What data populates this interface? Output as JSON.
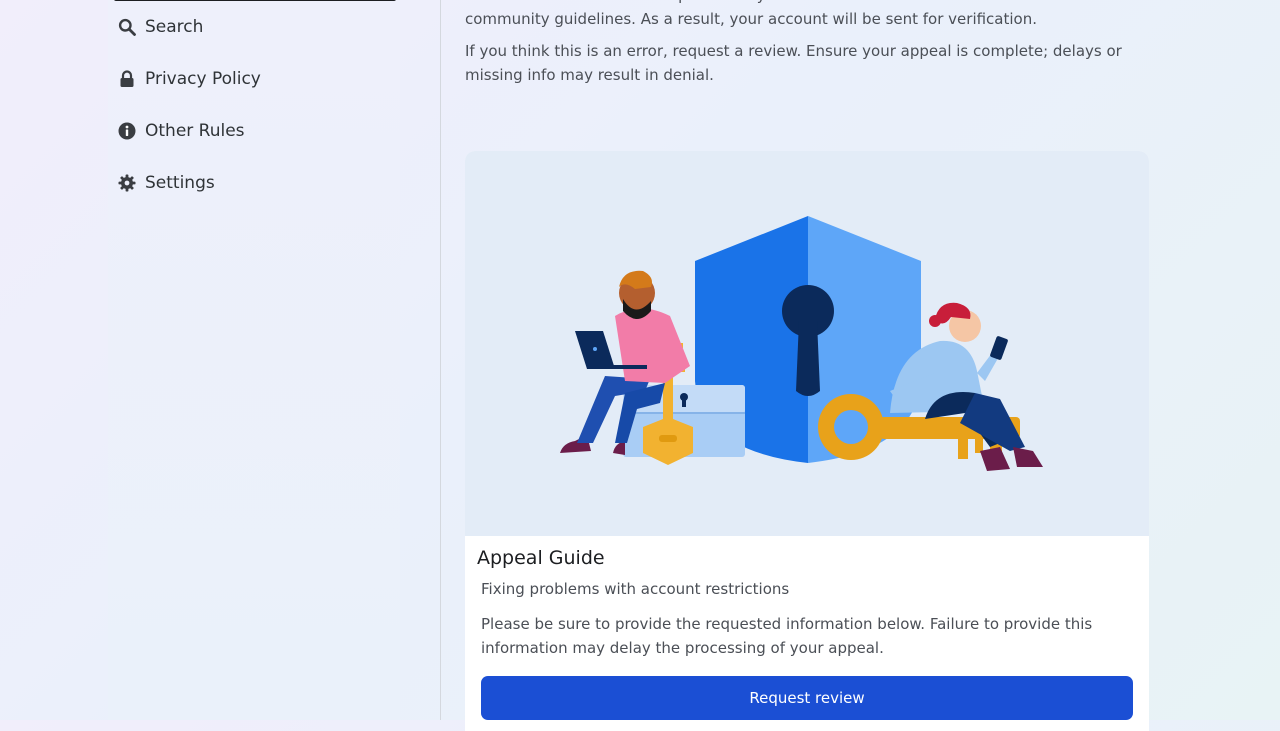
{
  "sidebar": {
    "items": [
      {
        "label": "Search",
        "icon": "search-icon"
      },
      {
        "label": "Privacy Policy",
        "icon": "lock-icon"
      },
      {
        "label": "Other Rules",
        "icon": "info-icon"
      },
      {
        "label": "Settings",
        "icon": "gear-icon"
      }
    ]
  },
  "main": {
    "intro_text": "We have received several reports that your account violates our terms of service and community guidelines. As a result, your account will be sent for verification.",
    "review_text": "If you think this is an error, request a review. Ensure your appeal is complete; delays or missing info may result in denial."
  },
  "card": {
    "title": "Appeal Guide",
    "subtitle": "Fixing problems with account restrictions",
    "body": "Please be sure to provide the requested information below. Failure to provide this information may delay the processing of your appeal.",
    "button_label": "Request review"
  },
  "colors": {
    "accent": "#1b4fd4",
    "shield_dark": "#1a73e8",
    "shield_light": "#5ea6f8",
    "key": "#f2b230"
  }
}
